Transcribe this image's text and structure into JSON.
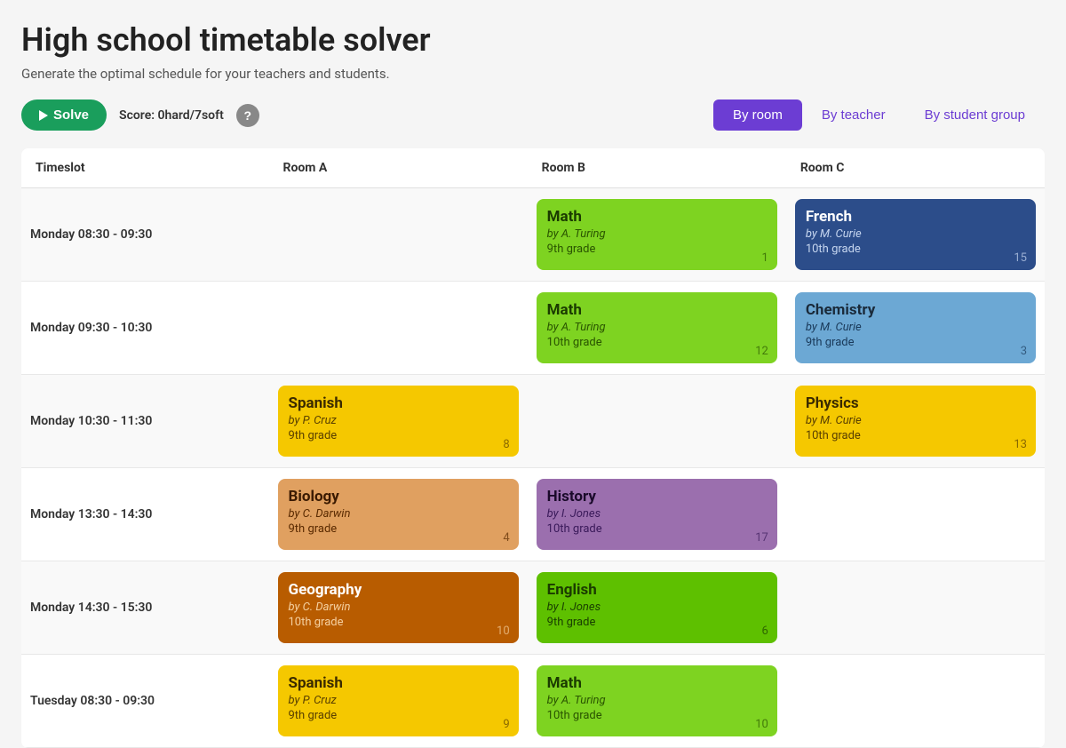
{
  "page": {
    "title": "High school timetable solver",
    "subtitle": "Generate the optimal schedule for your teachers and students."
  },
  "toolbar": {
    "solve_label": "Solve",
    "score_label": "Score: 0hard/7soft",
    "help_label": "?",
    "view_tabs": [
      {
        "id": "by-room",
        "label": "By room",
        "active": true
      },
      {
        "id": "by-teacher",
        "label": "By teacher",
        "active": false
      },
      {
        "id": "by-student-group",
        "label": "By student group",
        "active": false
      }
    ]
  },
  "table": {
    "headers": [
      "Timeslot",
      "Room A",
      "Room B",
      "Room C"
    ],
    "rows": [
      {
        "timeslot": "Monday 08:30 - 09:30",
        "rooms": [
          null,
          {
            "subject": "Math",
            "teacher": "by A. Turing",
            "grade": "9th grade",
            "count": "1",
            "color": "green"
          },
          {
            "subject": "French",
            "teacher": "by M. Curie",
            "grade": "10th grade",
            "count": "15",
            "color": "dark-blue"
          }
        ]
      },
      {
        "timeslot": "Monday 09:30 - 10:30",
        "rooms": [
          null,
          {
            "subject": "Math",
            "teacher": "by A. Turing",
            "grade": "10th grade",
            "count": "12",
            "color": "green"
          },
          {
            "subject": "Chemistry",
            "teacher": "by M. Curie",
            "grade": "9th grade",
            "count": "3",
            "color": "light-blue"
          }
        ]
      },
      {
        "timeslot": "Monday 10:30 - 11:30",
        "rooms": [
          {
            "subject": "Spanish",
            "teacher": "by P. Cruz",
            "grade": "9th grade",
            "count": "8",
            "color": "yellow"
          },
          null,
          {
            "subject": "Physics",
            "teacher": "by M. Curie",
            "grade": "10th grade",
            "count": "13",
            "color": "yellow"
          }
        ]
      },
      {
        "timeslot": "Monday 13:30 - 14:30",
        "rooms": [
          {
            "subject": "Biology",
            "teacher": "by C. Darwin",
            "grade": "9th grade",
            "count": "4",
            "color": "orange"
          },
          {
            "subject": "History",
            "teacher": "by I. Jones",
            "grade": "10th grade",
            "count": "17",
            "color": "purple"
          },
          null
        ]
      },
      {
        "timeslot": "Monday 14:30 - 15:30",
        "rooms": [
          {
            "subject": "Geography",
            "teacher": "by C. Darwin",
            "grade": "10th grade",
            "count": "10",
            "color": "dark-orange"
          },
          {
            "subject": "English",
            "teacher": "by I. Jones",
            "grade": "9th grade",
            "count": "6",
            "color": "bright-green"
          },
          null
        ]
      },
      {
        "timeslot": "Tuesday 08:30 - 09:30",
        "rooms": [
          {
            "subject": "Spanish",
            "teacher": "by P. Cruz",
            "grade": "9th grade",
            "count": "9",
            "color": "yellow"
          },
          {
            "subject": "Math",
            "teacher": "by A. Turing",
            "grade": "10th grade",
            "count": "10",
            "color": "green"
          },
          null
        ]
      }
    ]
  }
}
